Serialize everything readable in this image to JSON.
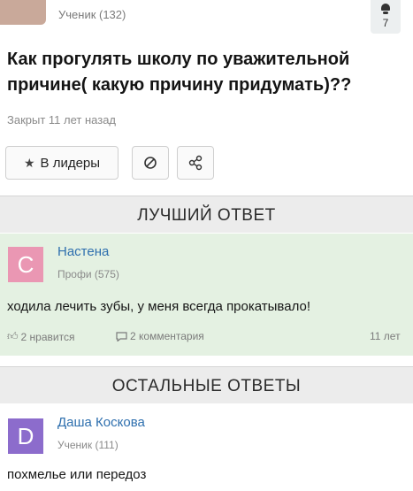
{
  "question_author": {
    "status": "Ученик (132)",
    "votes": "7"
  },
  "question": {
    "title": "Как прогулять школу по уважительной причине( какую причину придумать)??",
    "status": "Закрыт 11 лет назад"
  },
  "actions": {
    "leaders_label": "В лидеры",
    "leaders_icon": "star-icon",
    "block_icon": "block-icon",
    "share_icon": "share-icon"
  },
  "best_answer": {
    "header": "ЛУЧШИЙ ОТВЕТ",
    "avatar_letter": "С",
    "avatar_color": "#ea97b3",
    "author": "Настена",
    "rank": "Профи (575)",
    "text": "ходила лечить зубы, у меня всегда прокатывало!",
    "likes": "2 нравится",
    "comments": "2 комментария",
    "time": "11 лет"
  },
  "other_answers": {
    "header": "ОСТАЛЬНЫЕ ОТВЕТЫ",
    "items": [
      {
        "avatar_letter": "D",
        "avatar_color": "#8c6ccc",
        "author": "Даша Коскова",
        "rank": "Ученик (111)",
        "text": "похмелье или передоз"
      }
    ]
  }
}
